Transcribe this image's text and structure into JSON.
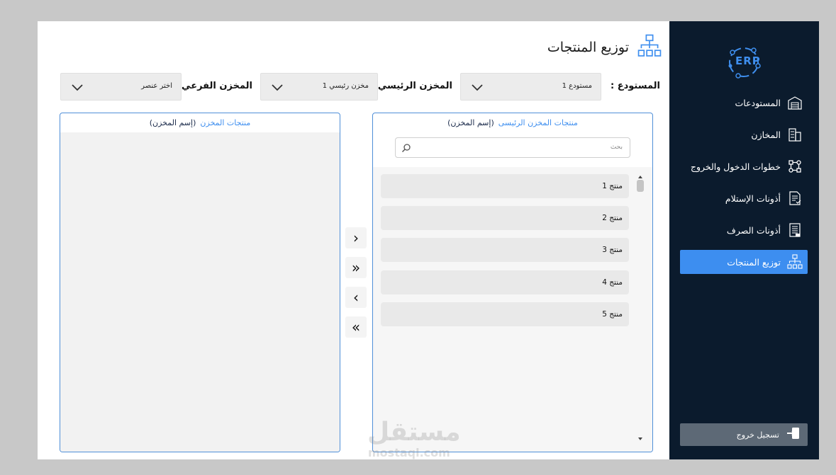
{
  "sidebar": {
    "logo_text": "ERP",
    "items": [
      {
        "label": "المستودعات",
        "icon": "warehouse-icon",
        "active": false
      },
      {
        "label": "المخازن",
        "icon": "stores-icon",
        "active": false
      },
      {
        "label": "خطوات الدخول والخروج",
        "icon": "flow-icon",
        "active": false
      },
      {
        "label": "أذونات الإستلام",
        "icon": "receipt-doc-icon",
        "active": false
      },
      {
        "label": "أذونات الصرف",
        "icon": "issue-doc-icon",
        "active": false
      },
      {
        "label": "توزيع المنتجات",
        "icon": "distribution-icon",
        "active": true
      }
    ],
    "logout_label": "تسجيل خروج"
  },
  "header": {
    "title": "توزيع المنتجات"
  },
  "filters": {
    "warehouse": {
      "label": "المستودع :",
      "value": "مستودع 1"
    },
    "main_store": {
      "label": "المخزن الرئيسي :",
      "value": "مخزن رئيسي 1"
    },
    "sub_store": {
      "label": "المخزن الفرعي :",
      "value": "اختر عنصر"
    }
  },
  "main_panel": {
    "title": "منتجات المخزن الرئيسى",
    "subtitle": "(إسم المخزن)",
    "search_placeholder": "بحث",
    "items": [
      "منتج 1",
      "منتج 2",
      "منتج 3",
      "منتج 4",
      "منتج 5"
    ]
  },
  "sub_panel": {
    "title": "منتجات المخزن",
    "subtitle": "(إسم المخزن)"
  },
  "transfer_buttons": [
    "›",
    "»",
    "‹",
    "«"
  ],
  "watermark": {
    "text": "مستقل",
    "sub": "mostaql.com"
  },
  "colors": {
    "sidebar_bg": "#0b1b2d",
    "accent": "#3d8ef0",
    "logout_bg": "#5d6976"
  }
}
